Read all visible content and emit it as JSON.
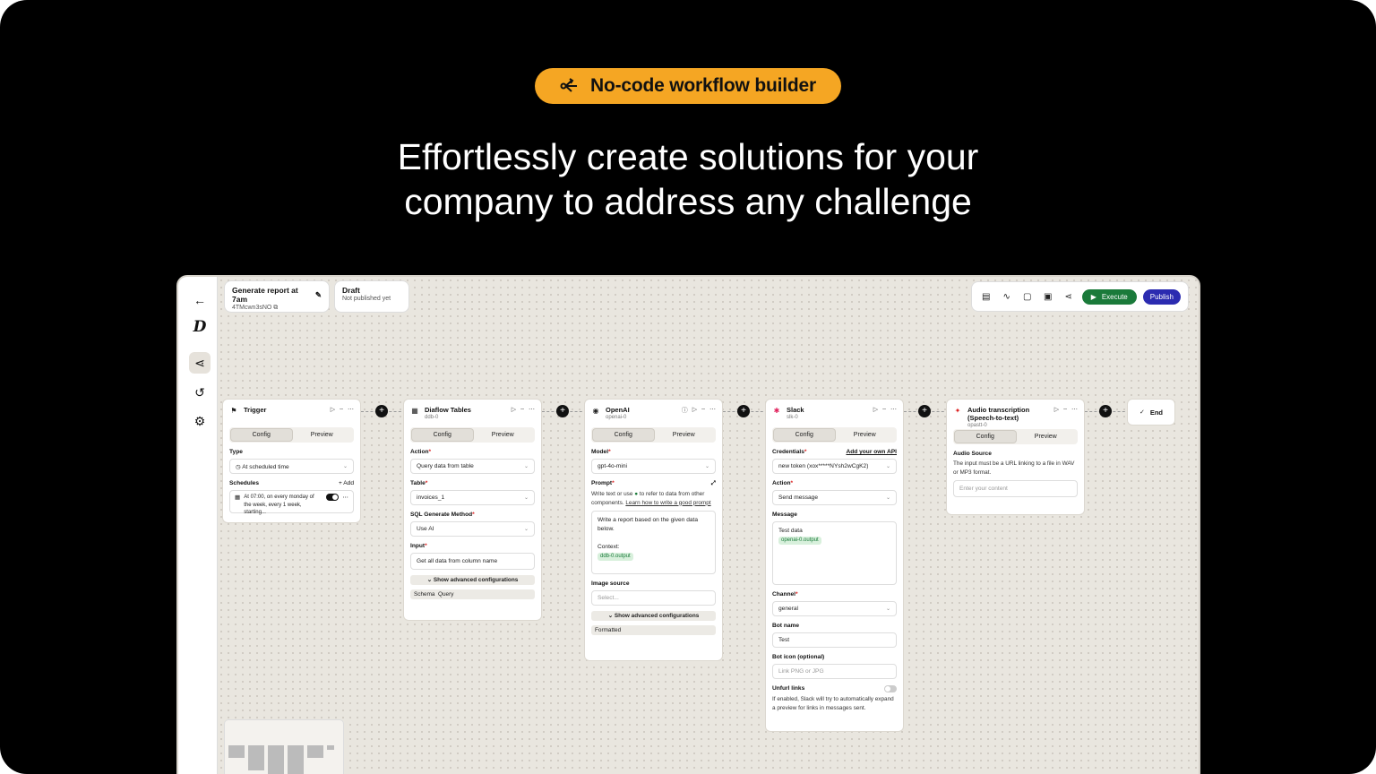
{
  "banner": {
    "pill_label": "No-code workflow builder",
    "headline_line1": "Effortlessly create solutions for your",
    "headline_line2": "company to address any challenge"
  },
  "workflow": {
    "name": "Generate report at 7am",
    "id": "4TMcwn3sNO",
    "status": "Draft",
    "status_sub": "Not published yet"
  },
  "toolbar": {
    "execute_label": "Execute",
    "publish_label": "Publish"
  },
  "tabs": {
    "config": "Config",
    "preview": "Preview"
  },
  "trigger": {
    "title": "Trigger",
    "type_label": "Type",
    "type_value": "At scheduled time",
    "schedules_label": "Schedules",
    "add_label": "+ Add",
    "schedule_text": "At 07:00, on every monday of the week, every 1 week, starting..."
  },
  "tables": {
    "title": "Diaflow Tables",
    "sub": "ddb-0",
    "action_label": "Action",
    "action_value": "Query data from table",
    "table_label": "Table",
    "table_value": "invoices_1",
    "sql_label": "SQL Generate Method",
    "sql_value": "Use AI",
    "input_label": "Input",
    "input_value": "Get all data from column name",
    "advanced": "Show advanced configurations",
    "schema": "Schema",
    "query": "Query"
  },
  "openai": {
    "title": "OpenAI",
    "sub": "openai-0",
    "model_label": "Model",
    "model_value": "gpt-4o-mini",
    "prompt_label": "Prompt",
    "prompt_help_a": "Write text or use",
    "prompt_help_b": "to refer to data from other components.",
    "prompt_link": "Learn how to write a good prompt",
    "prompt_line1": "Write a report based on the given data below.",
    "prompt_context": "Context:",
    "prompt_tag": "ddb-0.output",
    "image_label": "Image source",
    "image_placeholder": "Select...",
    "advanced": "Show advanced configurations",
    "formatted": "Formatted"
  },
  "slack": {
    "title": "Slack",
    "sub": "slk-0",
    "cred_label": "Credentials",
    "cred_link": "Add your own API",
    "cred_value": "new token (xox*****NYsh2wCgK2)",
    "action_label": "Action",
    "action_value": "Send message",
    "message_label": "Message",
    "message_text": "Test data",
    "message_tag": "openai-0.output",
    "channel_label": "Channel",
    "channel_value": "general",
    "botname_label": "Bot name",
    "botname_value": "Test",
    "boticon_label": "Bot icon (optional)",
    "boticon_placeholder": "Link PNG or JPG",
    "unfurl_label": "Unfurl links",
    "unfurl_help": "If enabled, Slack will try to automatically expand a preview for links in messages sent."
  },
  "audio": {
    "title": "Audio transcription (Speech-to-text)",
    "sub": "opastt-0",
    "source_label": "Audio Source",
    "source_help": "The input must be a URL linking to a file in WAV or MP3 format.",
    "placeholder": "Enter your content"
  },
  "end": {
    "label": "End"
  },
  "colors": {
    "accent": "#f5a623",
    "execute": "#1a7a3a",
    "publish": "#2b2bb0"
  }
}
